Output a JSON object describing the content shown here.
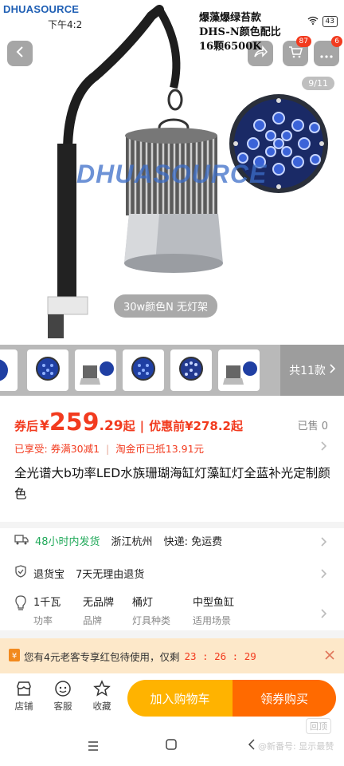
{
  "status": {
    "brand": "DHUASOURCE",
    "time": "下午4:2",
    "battery": "43"
  },
  "promo_overlay": {
    "line1": "爆藻爆绿苔款",
    "line2": "DHS-N颜色配比",
    "line3": "16颗6500K"
  },
  "header": {
    "cart_badge": "87",
    "more_badge": "6"
  },
  "gallery": {
    "counter": "9/11",
    "watermark": "DHUASOURCE",
    "variant_label": "30w颜色N 无灯架"
  },
  "thumbnails": {
    "count_label": "共11款"
  },
  "price": {
    "coupon_prefix": "券后",
    "currency": "¥",
    "integer": "259",
    "decimal": ".29",
    "suffix": "起",
    "original_label": "优惠前¥278.2起",
    "sold": "已售 0",
    "enjoyed": "已享受:",
    "coupon_deal": "券满30减1",
    "coin_deal": "淘金币已抵13.91元"
  },
  "product": {
    "title": "全光谱大b功率LED水族珊瑚海缸灯藻缸灯全蓝补光定制颜色"
  },
  "shipping": {
    "tag": "48小时内发货",
    "origin": "浙江杭州",
    "express": "快递: 免运费"
  },
  "returns": {
    "tag": "退货宝",
    "policy": "7天无理由退货"
  },
  "params": [
    {
      "value": "1千瓦",
      "key": "功率"
    },
    {
      "value": "无品牌",
      "key": "品牌"
    },
    {
      "value": "桶灯",
      "key": "灯具种类"
    },
    {
      "value": "中型鱼缸",
      "key": "适用场景"
    }
  ],
  "notice": {
    "text": "您有4元老客专享红包待使用，仅剩",
    "countdown": "23 : 26 : 29"
  },
  "bottom_nav": {
    "store": "店铺",
    "service": "客服",
    "favorite": "收藏",
    "add_to_cart": "加入购物车",
    "buy_now": "领券购买",
    "back_top": "回顶"
  },
  "system_nav": {
    "watermark": "@新番号: 显示最赞"
  },
  "colors": {
    "accent": "#f23b1f",
    "cart_button": "#ffb300",
    "buy_button": "#ff6a00",
    "notice_bg": "#fde8c9",
    "shipping_green": "#21a95a"
  }
}
